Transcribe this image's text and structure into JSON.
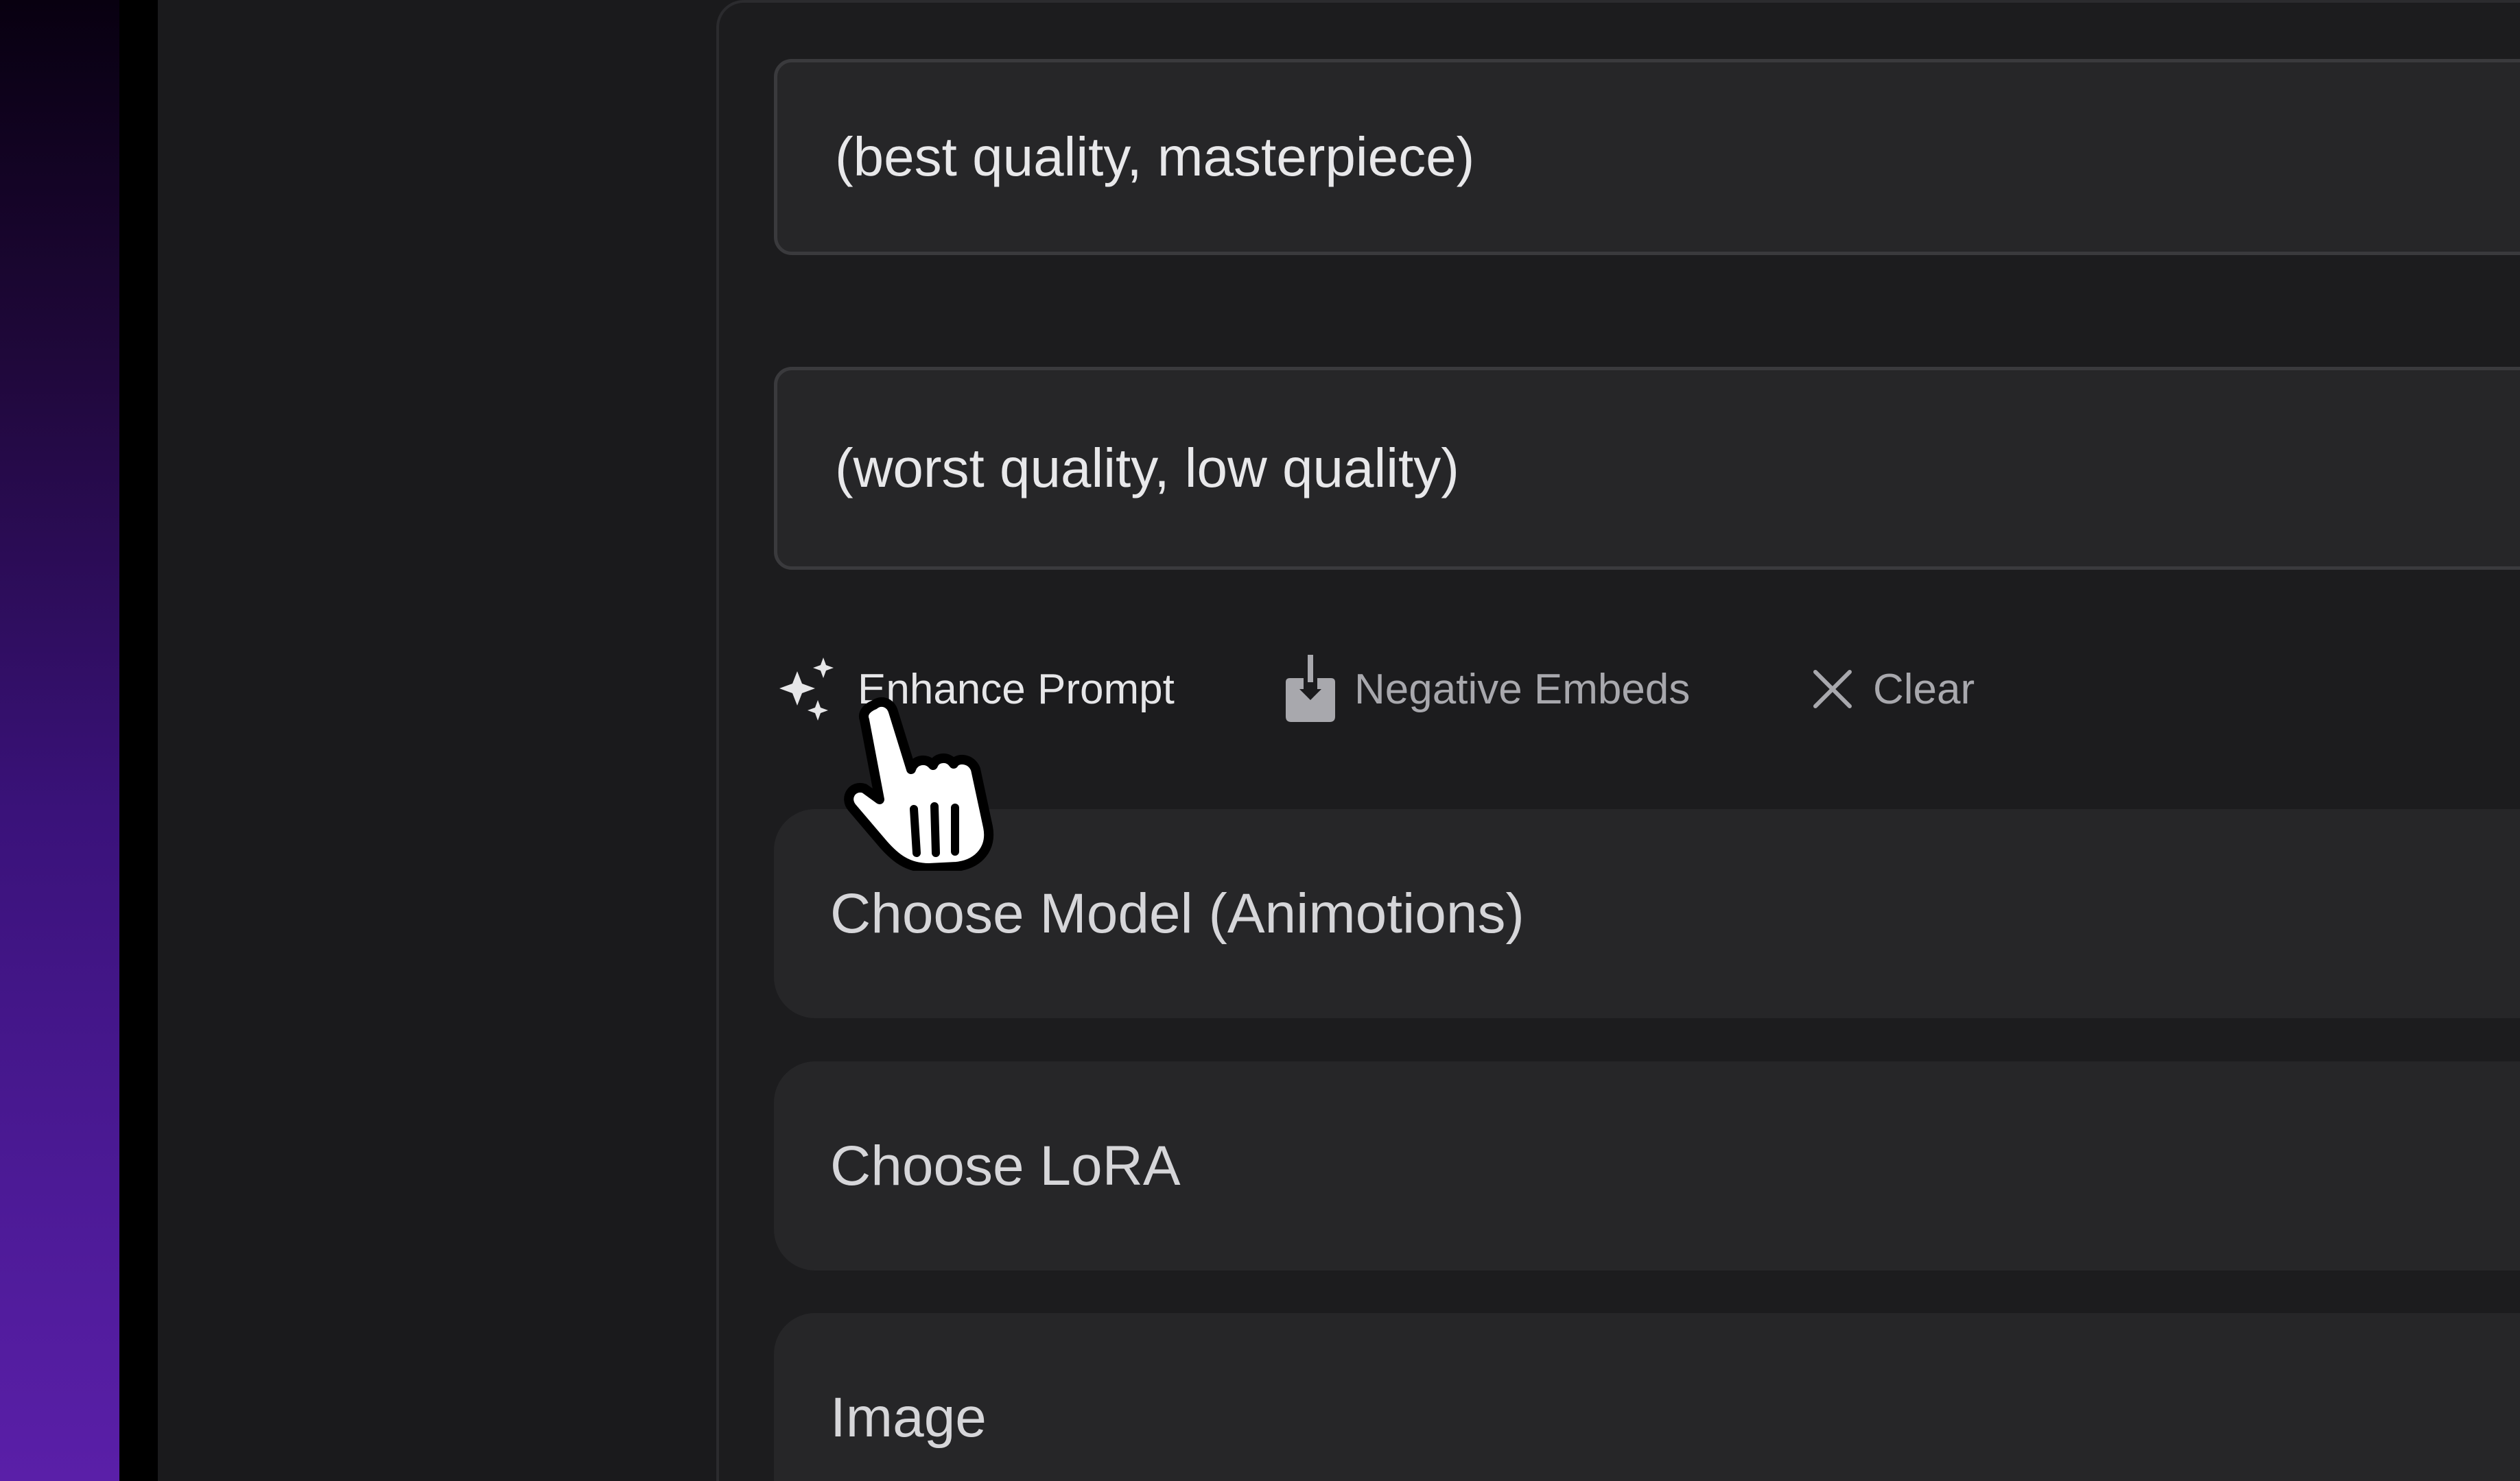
{
  "prompts": {
    "positive": "(best quality, masterpiece)",
    "negative": "(worst quality, low quality)"
  },
  "actions": {
    "enhance_prompt": "Enhance Prompt",
    "negative_embeds": "Negative Embeds",
    "clear": "Clear"
  },
  "selectors": {
    "model": "Choose Model (Animotions)",
    "lora": "Choose LoRA",
    "image": "Image"
  },
  "icons": {
    "enhance": "sparkles-icon",
    "negative_embeds": "download-icon",
    "clear": "close-icon",
    "cursor": "hand-pointer-cursor"
  },
  "colors": {
    "background": "#1a1a1c",
    "panel": "#1c1c1e",
    "field": "#262628",
    "accent_purple": "#5a1fa8"
  }
}
